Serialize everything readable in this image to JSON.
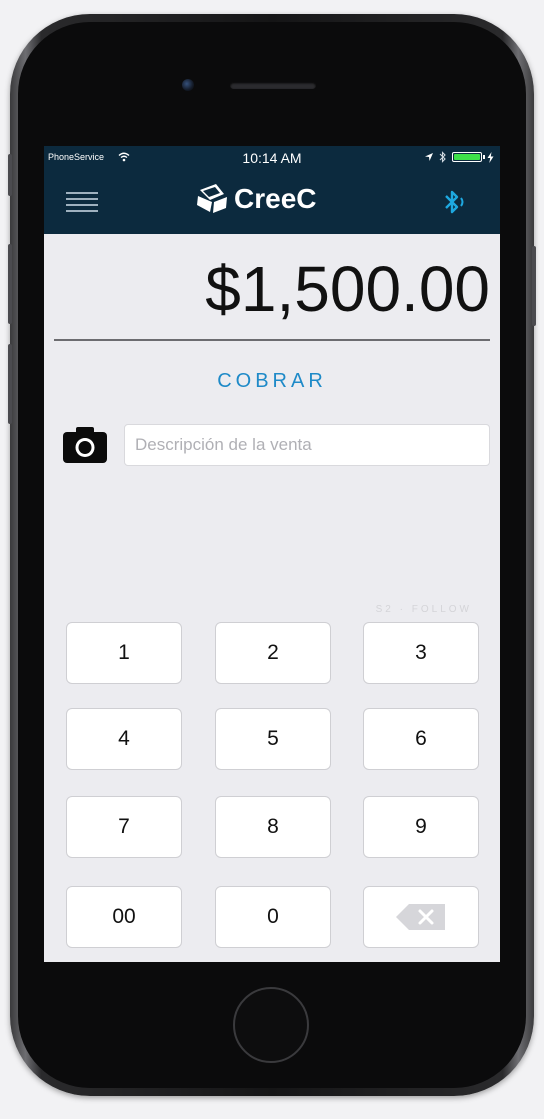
{
  "status_bar": {
    "carrier": "PhoneService",
    "time": "10:14 AM"
  },
  "nav": {
    "brand": "CreeC",
    "menu_icon": "hamburger-menu-icon",
    "bluetooth_icon": "bluetooth-icon",
    "bluetooth_color": "#1ea8e0"
  },
  "amount": {
    "value": "$1,500.00"
  },
  "charge": {
    "label": "COBRAR",
    "color": "#1e8ac8"
  },
  "description": {
    "placeholder": "Descripción de la venta",
    "value": ""
  },
  "watermark": "S2 · FOLLOW",
  "keypad": {
    "keys": [
      "1",
      "2",
      "3",
      "4",
      "5",
      "6",
      "7",
      "8",
      "9",
      "00",
      "0"
    ],
    "backspace_icon": "backspace-icon"
  },
  "colors": {
    "nav_background": "#0c2a3e",
    "screen_background": "#ececf0",
    "battery": "#3ee14a"
  }
}
